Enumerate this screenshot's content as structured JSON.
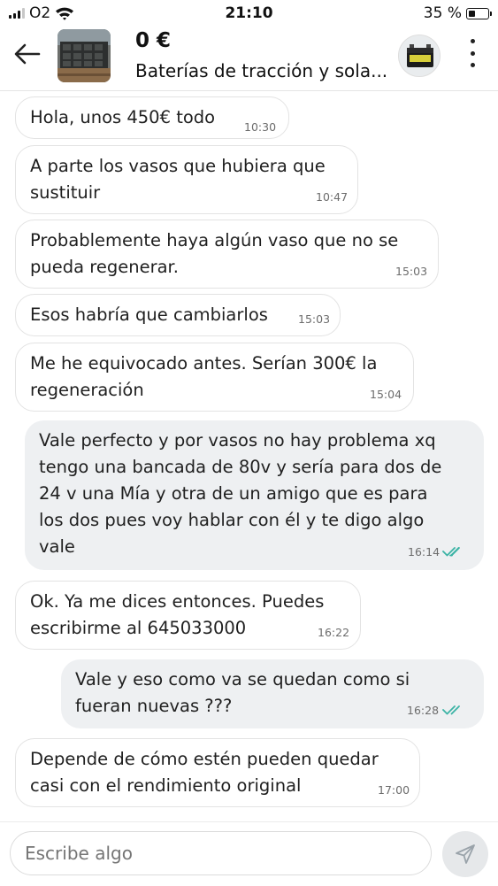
{
  "status_bar": {
    "carrier": "O2",
    "time": "21:10",
    "battery_percent": "35 %",
    "battery_level": 0.35
  },
  "header": {
    "back_icon": "arrow-left-icon",
    "price": "0 €",
    "title": "Baterías de tracción y sola...",
    "menu_icon": "more-vertical-icon"
  },
  "messages": [
    {
      "direction": "in",
      "lines": [
        "Hola, unos 450€ todo"
      ],
      "time": "10:30"
    },
    {
      "direction": "in",
      "lines": [
        "A parte los vasos que hubiera que",
        "sustituir"
      ],
      "time": "10:47"
    },
    {
      "direction": "in",
      "lines": [
        "Probablemente haya algún vaso que no se",
        "pueda regenerar."
      ],
      "time": "15:03"
    },
    {
      "direction": "in",
      "lines": [
        "Esos habría que cambiarlos"
      ],
      "time": "15:03"
    },
    {
      "direction": "in",
      "lines": [
        "Me he equivocado antes. Serían 300€ la",
        "regeneración"
      ],
      "time": "15:04"
    },
    {
      "direction": "out",
      "lines": [
        "Vale perfecto y por vasos no hay problema xq",
        "tengo una bancada de 80v y sería para dos de",
        "24 v una Mía y otra de un amigo que es para",
        "los dos pues voy hablar con él y te digo algo",
        "vale"
      ],
      "time": "16:14",
      "status": "read"
    },
    {
      "direction": "in",
      "lines": [
        "Ok. Ya me dices entonces. Puedes",
        "escribirme al 645033000"
      ],
      "time": "16:22"
    },
    {
      "direction": "out",
      "lines": [
        "Vale y eso como va se quedan como si",
        "fueran nuevas ???"
      ],
      "time": "16:28",
      "status": "read"
    },
    {
      "direction": "in",
      "lines": [
        "Depende de cómo estén pueden quedar",
        "casi con el rendimiento original"
      ],
      "time": "17:00"
    }
  ],
  "composer": {
    "placeholder": "Escribe algo",
    "send_icon": "send-icon"
  },
  "colors": {
    "incoming_bubble": "#ffffff",
    "outgoing_bubble": "#eef0f2",
    "read_ticks": "#3bb3a5",
    "send_button": "#e6e8ea"
  }
}
